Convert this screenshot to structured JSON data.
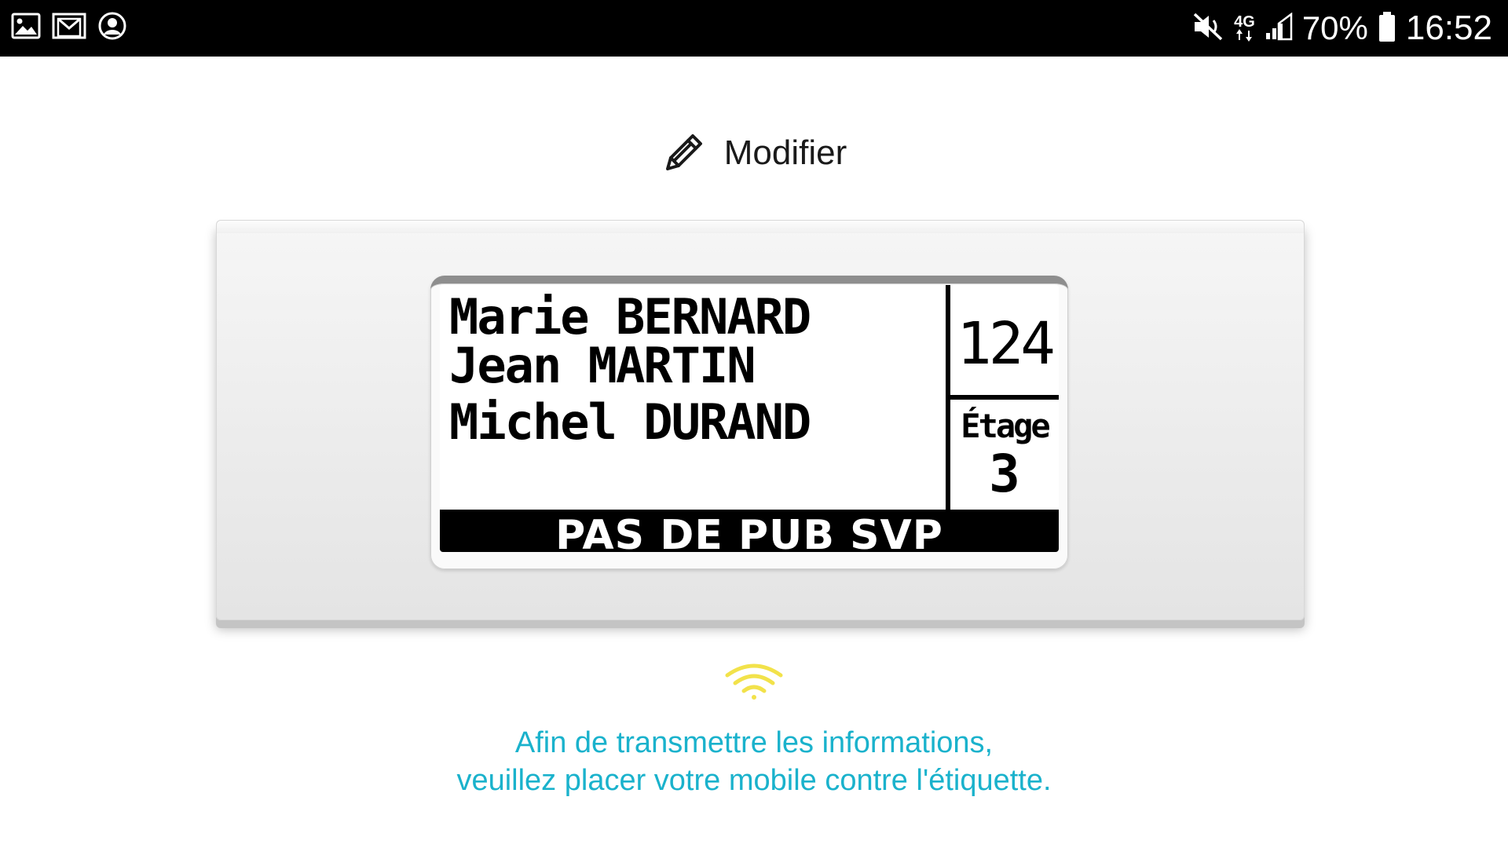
{
  "status_bar": {
    "battery_percent": "70%",
    "time": "16:52",
    "network_type": "4G",
    "left_icons": [
      "gallery-icon",
      "mail-icon",
      "account-icon"
    ],
    "right_icons": [
      "vibrate-mute-icon",
      "network-4g-icon",
      "signal-icon",
      "battery-icon"
    ]
  },
  "header": {
    "title": "Modifier",
    "icon": "pencil-icon"
  },
  "label_preview": {
    "names": [
      "Marie BERNARD",
      "Jean MARTIN",
      "Michel DURAND"
    ],
    "apartment_number": "124",
    "floor_label": "Étage",
    "floor_number": "3",
    "footer_text": "PAS DE PUB SVP"
  },
  "instructions": {
    "icon": "nfc-waves-icon",
    "line1": "Afin de transmettre les informations,",
    "line2": "veuillez placer votre mobile contre l'étiquette."
  },
  "colors": {
    "status_bar_bg": "#000000",
    "accent_text": "#1ab2cc",
    "nfc_icon": "#f2e24a",
    "screen_text": "#000000"
  }
}
